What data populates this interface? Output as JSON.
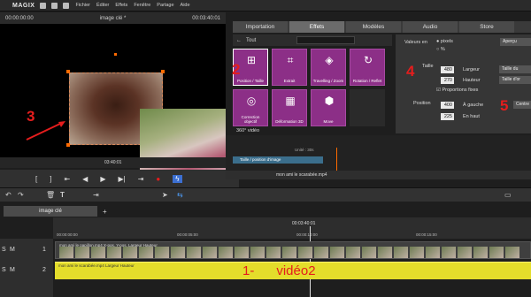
{
  "app": {
    "logo": "MAGIX",
    "menu": [
      "Fichier",
      "Éditer",
      "Effets",
      "Fenêtre",
      "Partage",
      "Aide"
    ]
  },
  "preview": {
    "time_left": "00:00:00:00",
    "title": "image clé *",
    "time_right": "00:03:40:01",
    "timebar_tc": "03:40:01"
  },
  "tabs": [
    "Importation",
    "Effets",
    "Modèles",
    "Audio",
    "Store"
  ],
  "effects": {
    "back_label": "Tout",
    "items": [
      {
        "label": "Position / Taille",
        "glyph": "⊞"
      },
      {
        "label": "Extrait",
        "glyph": "⌗"
      },
      {
        "label": "Travelling / Zoom",
        "glyph": "◈"
      },
      {
        "label": "Rotation / Reflet",
        "glyph": "↻"
      },
      {
        "label": "Correction objectif",
        "glyph": "◎"
      },
      {
        "label": "Déformation 3D",
        "glyph": "▦"
      },
      {
        "label": "Move",
        "glyph": "⬢"
      }
    ],
    "section": "360° vidéo"
  },
  "props": {
    "units_label": "Valeurs en",
    "unit_pixels": "pixels",
    "unit_percent": "%",
    "apercu": "Aperçu",
    "size_label": "Taille",
    "width": "480",
    "width_label": "Largeur",
    "height": "270",
    "height_label": "Hauteur",
    "full_width": "Taille du",
    "full_height": "Taille d'or",
    "keep_ratio": "Proportions fixes",
    "position_label": "Position",
    "pos_x": "400",
    "pos_x_label": "À gauche",
    "pos_y": "225",
    "pos_y_label": "En haut",
    "center": "Centre"
  },
  "keyframes": {
    "unit": "Unité : 30s",
    "track_label": "Taille / position d'image",
    "clip_title": "mon ami le scarabée.mp4"
  },
  "project": {
    "tab": "image clé",
    "playhead": "00:03:40:01",
    "ticks": [
      "00:00:00:00",
      "00:00:05:00",
      "00:00:10:00",
      "00:00:15:00"
    ]
  },
  "tracks": [
    {
      "number": "1",
      "clip": "mon ami le papillon.mp4   X-pos.  Y-pos.  Largeur  Hauteur"
    },
    {
      "number": "2",
      "clip": "mon ami le scarabée.mp4   Largeur  Hauteur"
    }
  ],
  "annotations": {
    "a2": "2",
    "a3": "3",
    "a4": "4",
    "a5": "5",
    "bottom": "1-      vidéo2"
  },
  "colors": {
    "effect_tile": "#8c2f87",
    "video2_clip": "#e4dd2b",
    "annotation_red": "#e51d1d",
    "keyframe_bar": "#3b6e8c"
  }
}
